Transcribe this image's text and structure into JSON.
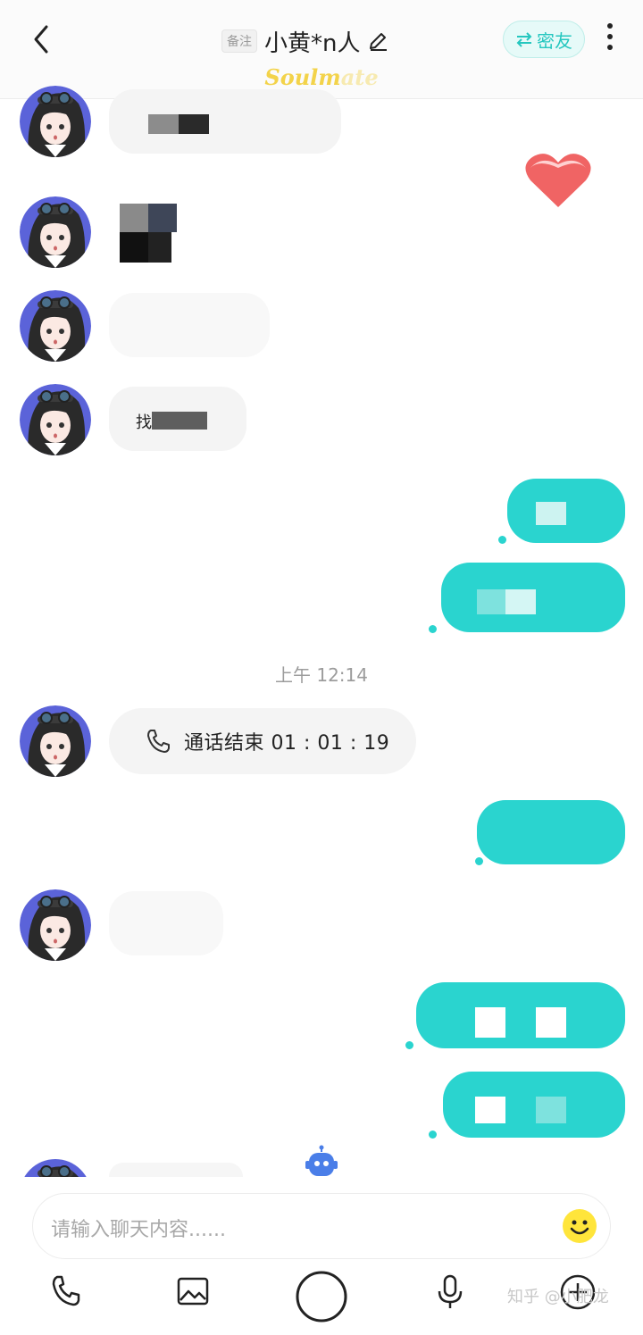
{
  "header": {
    "note_tag": "备注",
    "title": "小黄*n人",
    "badge_prefix": "Soulm",
    "badge_suffix": "ate",
    "close_friend_label": "密友"
  },
  "chat": {
    "partial_text_1": "找",
    "timestamp": "上午 12:14",
    "call_text": "通话结束 01 : 01 : 19"
  },
  "input": {
    "placeholder": "请输入聊天内容......"
  },
  "watermark": "知乎 @小肥龙",
  "colors": {
    "accent": "#2ad4cf",
    "incoming_bubble": "#f4f4f4",
    "avatar_bg": "#5b63d9",
    "heart": "#f06464"
  }
}
